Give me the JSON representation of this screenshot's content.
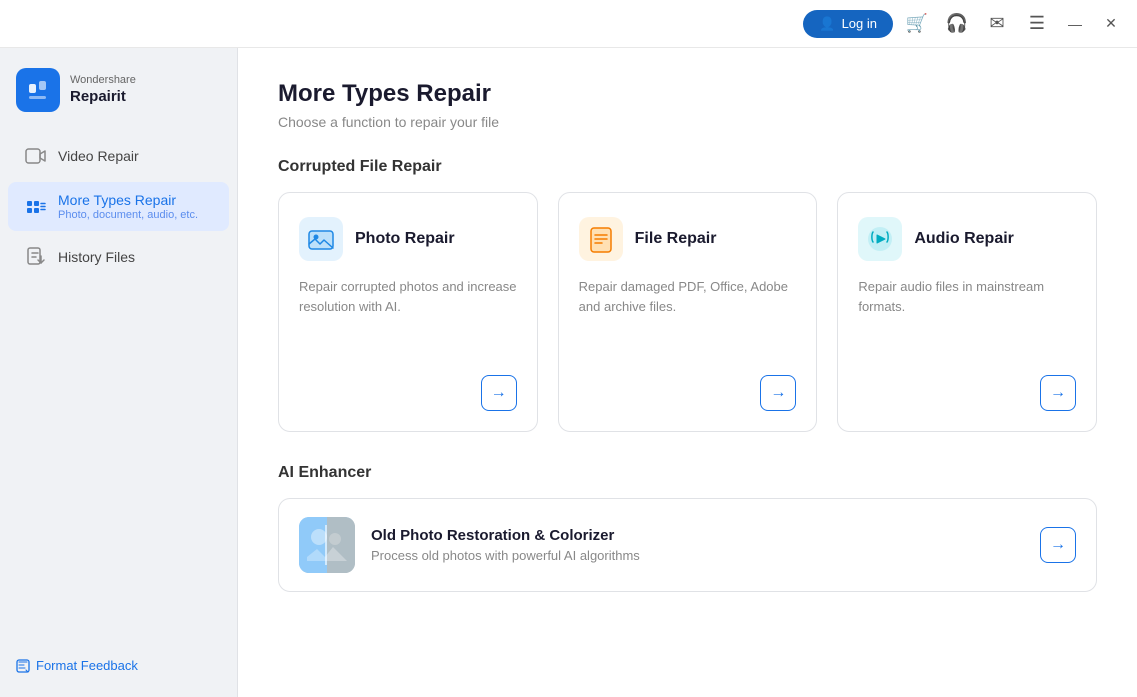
{
  "titleBar": {
    "loginLabel": "Log in",
    "cartIcon": "🛒",
    "headsetIcon": "🎧",
    "mailIcon": "✉",
    "menuIcon": "☰",
    "minimizeIcon": "—",
    "closeIcon": "✕"
  },
  "sidebar": {
    "brand": "Wondershare",
    "product": "Repairit",
    "navItems": [
      {
        "id": "video-repair",
        "label": "Video Repair",
        "sublabel": "",
        "active": false
      },
      {
        "id": "more-types-repair",
        "label": "More Types Repair",
        "sublabel": "Photo, document, audio, etc.",
        "active": true
      },
      {
        "id": "history-files",
        "label": "History Files",
        "sublabel": "",
        "active": false
      }
    ],
    "footerLink": "Format Feedback"
  },
  "main": {
    "pageTitle": "More Types Repair",
    "pageSubtitle": "Choose a function to repair your file",
    "corruptedSection": {
      "title": "Corrupted File Repair",
      "cards": [
        {
          "id": "photo-repair",
          "title": "Photo Repair",
          "desc": "Repair corrupted photos and increase resolution with AI.",
          "iconType": "photo"
        },
        {
          "id": "file-repair",
          "title": "File Repair",
          "desc": "Repair damaged PDF, Office, Adobe and archive files.",
          "iconType": "file"
        },
        {
          "id": "audio-repair",
          "title": "Audio Repair",
          "desc": "Repair audio files in mainstream formats.",
          "iconType": "audio"
        }
      ]
    },
    "aiSection": {
      "title": "AI Enhancer",
      "card": {
        "id": "old-photo-restoration",
        "title": "Old Photo Restoration & Colorizer",
        "desc": "Process old photos with powerful AI algorithms"
      }
    }
  }
}
